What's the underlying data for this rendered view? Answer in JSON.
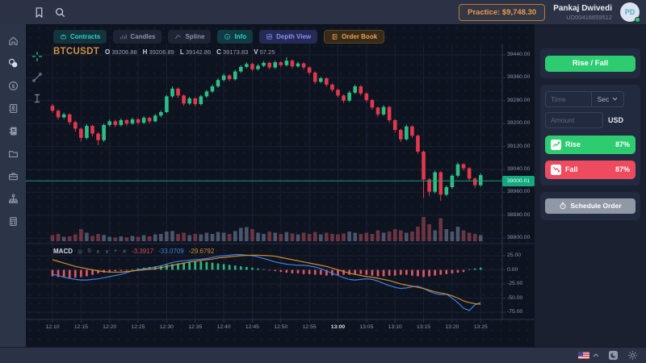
{
  "topbar": {
    "practice_label": "Practice: $9,748.30",
    "user_name": "Pankaj Dwivedi",
    "user_id": "UD00416659512",
    "avatar_initials": "PD"
  },
  "toolbar": {
    "chips": [
      {
        "icon": "briefcase-icon",
        "label": "Contracts"
      },
      {
        "icon": "bar-chart-icon",
        "label": "Candles"
      },
      {
        "icon": "line-chart-icon",
        "label": "Spline"
      },
      {
        "icon": "info-icon",
        "label": "Info"
      },
      {
        "icon": "depth-icon",
        "label": "Depth View"
      },
      {
        "icon": "book-icon",
        "label": "Order Book"
      }
    ]
  },
  "sidebar_icons": [
    "home-icon",
    "coins-icon",
    "dollar-coin-icon",
    "contacts-icon",
    "ledger-icon",
    "folder-icon",
    "briefcase-icon",
    "network-icon",
    "calculator-icon"
  ],
  "symbol_header": {
    "symbol": "BTCUSDT",
    "o_label": "O",
    "o": "39206.88",
    "h_label": "H",
    "h": "39206.89",
    "l_label": "L",
    "l": "39142.86",
    "c_label": "C",
    "c": "39173.83",
    "v_label": "V",
    "v": "57.25"
  },
  "macd_header": {
    "title": "MACD",
    "controls": [
      "◎",
      "S",
      "∧",
      "∨",
      "+",
      "✕"
    ],
    "hist_value": "-3.3917",
    "macd_value": "-33.0709",
    "signal_value": "-29.6792"
  },
  "price_tag": "39000.01",
  "right_panel": {
    "rise_fall_label": "Rise / Fall",
    "time_placeholder": "Time",
    "time_unit": "Sec",
    "amount_placeholder": "Amount",
    "currency": "USD",
    "rise_label": "Rise",
    "rise_pct": "87%",
    "fall_label": "Fall",
    "fall_pct": "87%",
    "schedule_label": "Schedule Order"
  },
  "colors": {
    "candle_up": "#2ebd85",
    "candle_down": "#e1384c",
    "vol_up": "#55617a",
    "vol_down": "#7c3b49",
    "hist_up": "#2ebd85",
    "hist_down": "#e25a68",
    "macd_line": "#3f7fe0",
    "signal_line": "#cf8a33",
    "price_line": "#16a57b",
    "grid": "#1a2133",
    "axis": "#2c3550",
    "accent_green": "#2ecc71",
    "accent_red": "#ee4b5f",
    "accent_orange": "#eb9b49",
    "accent_teal": "#2bd4c4",
    "accent_purple": "#8a8ff4"
  },
  "chart_data": {
    "type": "candlestick",
    "title": "BTCUSDT 1-minute candles with volume and MACD",
    "x_labels": [
      "12:10",
      "12:15",
      "12:20",
      "12:25",
      "12:30",
      "12:35",
      "12:40",
      "12:45",
      "12:50",
      "12:55",
      "13:00",
      "13:05",
      "13:10",
      "13:15",
      "13:20",
      "13:25"
    ],
    "highlighted_x_label": "13:00",
    "price_ticks": [
      39440,
      39360,
      39280,
      39200,
      39120,
      39040,
      38960,
      38880,
      38800
    ],
    "price_range": [
      38790,
      39460
    ],
    "current_price": 39000.01,
    "candles": [
      [
        39262,
        39268,
        39238,
        39245
      ],
      [
        39245,
        39250,
        39214,
        39222
      ],
      [
        39222,
        39238,
        39216,
        39232
      ],
      [
        39232,
        39236,
        39196,
        39205
      ],
      [
        39205,
        39210,
        39172,
        39182
      ],
      [
        39182,
        39186,
        39138,
        39150
      ],
      [
        39150,
        39198,
        39144,
        39192
      ],
      [
        39192,
        39196,
        39155,
        39165
      ],
      [
        39165,
        39170,
        39125,
        39142
      ],
      [
        39142,
        39200,
        39136,
        39195
      ],
      [
        39195,
        39214,
        39190,
        39208
      ],
      [
        39208,
        39213,
        39188,
        39195
      ],
      [
        39195,
        39218,
        39190,
        39212
      ],
      [
        39212,
        39216,
        39193,
        39200
      ],
      [
        39200,
        39221,
        39196,
        39215
      ],
      [
        39215,
        39219,
        39196,
        39203
      ],
      [
        39203,
        39226,
        39198,
        39220
      ],
      [
        39220,
        39224,
        39200,
        39208
      ],
      [
        39208,
        39234,
        39204,
        39228
      ],
      [
        39228,
        39246,
        39222,
        39240
      ],
      [
        39240,
        39300,
        39236,
        39295
      ],
      [
        39295,
        39330,
        39290,
        39322
      ],
      [
        39322,
        39326,
        39290,
        39298
      ],
      [
        39298,
        39302,
        39262,
        39270
      ],
      [
        39270,
        39294,
        39265,
        39288
      ],
      [
        39288,
        39292,
        39260,
        39268
      ],
      [
        39268,
        39300,
        39263,
        39295
      ],
      [
        39295,
        39318,
        39290,
        39312
      ],
      [
        39312,
        39336,
        39307,
        39330
      ],
      [
        39330,
        39358,
        39325,
        39352
      ],
      [
        39352,
        39374,
        39347,
        39368
      ],
      [
        39368,
        39372,
        39348,
        39355
      ],
      [
        39355,
        39388,
        39350,
        39382
      ],
      [
        39382,
        39404,
        39377,
        39398
      ],
      [
        39398,
        39414,
        39393,
        39408
      ],
      [
        39408,
        39412,
        39383,
        39390
      ],
      [
        39390,
        39408,
        39385,
        39402
      ],
      [
        39402,
        39418,
        39397,
        39412
      ],
      [
        39412,
        39416,
        39389,
        39396
      ],
      [
        39396,
        39420,
        39391,
        39414
      ],
      [
        39414,
        39418,
        39397,
        39404
      ],
      [
        39404,
        39432,
        39399,
        39420
      ],
      [
        39420,
        39424,
        39393,
        39400
      ],
      [
        39400,
        39416,
        39395,
        39410
      ],
      [
        39410,
        39414,
        39389,
        39396
      ],
      [
        39396,
        39400,
        39371,
        39378
      ],
      [
        39378,
        39382,
        39338,
        39346
      ],
      [
        39346,
        39364,
        39341,
        39358
      ],
      [
        39358,
        39362,
        39329,
        39336
      ],
      [
        39336,
        39340,
        39311,
        39318
      ],
      [
        39318,
        39322,
        39291,
        39298
      ],
      [
        39298,
        39302,
        39272,
        39280
      ],
      [
        39280,
        39314,
        39275,
        39308
      ],
      [
        39308,
        39336,
        39303,
        39330
      ],
      [
        39330,
        39334,
        39298,
        39305
      ],
      [
        39305,
        39309,
        39274,
        39282
      ],
      [
        39282,
        39286,
        39248,
        39256
      ],
      [
        39256,
        39260,
        39224,
        39232
      ],
      [
        39232,
        39264,
        39227,
        39258
      ],
      [
        39258,
        39262,
        39204,
        39212
      ],
      [
        39212,
        39216,
        39170,
        39178
      ],
      [
        39178,
        39182,
        39136,
        39145
      ],
      [
        39145,
        39196,
        39140,
        39190
      ],
      [
        39190,
        39194,
        39150,
        39158
      ],
      [
        39158,
        39162,
        39094,
        39102
      ],
      [
        39102,
        39106,
        38940,
        39005
      ],
      [
        39005,
        39010,
        38948,
        38962
      ],
      [
        38962,
        39036,
        38956,
        39030
      ],
      [
        39030,
        39034,
        38930,
        38952
      ],
      [
        38952,
        38984,
        38946,
        38978
      ],
      [
        38978,
        39024,
        38972,
        39018
      ],
      [
        39018,
        39064,
        39012,
        39058
      ],
      [
        39058,
        39062,
        39036,
        39044
      ],
      [
        39044,
        39048,
        39000,
        39008
      ],
      [
        39008,
        39012,
        38976,
        38985
      ],
      [
        38985,
        39026,
        38980,
        39020
      ]
    ],
    "volume": [
      0.25,
      0.3,
      0.18,
      0.2,
      0.28,
      0.5,
      0.35,
      0.22,
      0.3,
      0.26,
      0.18,
      0.15,
      0.2,
      0.16,
      0.22,
      0.18,
      0.25,
      0.2,
      0.28,
      0.3,
      0.4,
      0.42,
      0.3,
      0.35,
      0.25,
      0.3,
      0.28,
      0.35,
      0.3,
      0.38,
      0.35,
      0.3,
      0.42,
      0.55,
      0.58,
      0.5,
      0.35,
      0.3,
      0.4,
      0.35,
      0.3,
      0.38,
      0.32,
      0.28,
      0.35,
      0.3,
      0.38,
      0.28,
      0.35,
      0.3,
      0.28,
      0.32,
      0.4,
      0.35,
      0.3,
      0.35,
      0.3,
      0.45,
      0.35,
      0.4,
      0.5,
      0.45,
      0.35,
      0.4,
      0.6,
      1.0,
      0.7,
      0.45,
      0.95,
      0.5,
      0.4,
      0.6,
      0.45,
      0.35,
      0.3,
      0.25
    ],
    "macd": {
      "y_ticks": [
        25,
        0,
        -25,
        -50,
        -75
      ],
      "histogram": [
        -9,
        -10,
        -11,
        -12,
        -11,
        -10,
        -9,
        -7,
        -5,
        -4,
        -3,
        -2,
        -1.5,
        -1,
        1,
        2,
        3,
        4,
        5,
        6,
        7,
        8,
        9,
        10,
        11,
        12,
        12,
        11,
        10,
        9,
        8,
        7,
        6,
        5,
        4,
        3,
        2,
        1,
        -1,
        -2,
        -3,
        -4,
        -5,
        -5,
        -6,
        -6,
        -7,
        -7,
        -8,
        -8,
        -8,
        -7,
        -7,
        -6,
        -6,
        -7,
        -8,
        -9,
        -9,
        -8,
        -8,
        -7,
        -7,
        -8,
        -9,
        -10,
        -9,
        -8,
        -7,
        -6,
        -5,
        -4,
        -3,
        1,
        2,
        3
      ],
      "macd_line": [
        -8,
        -10,
        -13,
        -15,
        -17,
        -18,
        -18,
        -17,
        -16,
        -14,
        -12,
        -10,
        -8,
        -5,
        -2,
        0,
        2,
        3,
        5,
        7,
        10,
        13,
        15,
        16,
        17,
        18,
        19,
        20,
        22,
        24,
        25,
        26,
        27,
        27,
        26,
        25,
        23,
        20,
        17,
        14,
        12,
        10,
        9,
        8,
        8,
        7,
        5,
        2,
        -2,
        -6,
        -10,
        -14,
        -17,
        -18,
        -17,
        -16,
        -17,
        -20,
        -24,
        -28,
        -31,
        -33,
        -32,
        -30,
        -29,
        -33,
        -38,
        -42,
        -44,
        -43,
        -50,
        -58,
        -68,
        -72,
        -62,
        -58
      ],
      "signal_line": [
        18,
        15,
        12,
        9,
        6,
        4,
        2,
        0,
        -2,
        -3,
        -4,
        -4,
        -4,
        -3,
        -2,
        -1,
        0,
        1,
        2,
        4,
        6,
        8,
        10,
        12,
        14,
        15,
        17,
        18,
        19,
        21,
        22,
        23,
        24,
        25,
        25.5,
        26,
        26,
        25.5,
        25,
        24,
        22,
        20,
        18,
        16,
        14,
        12,
        10,
        8,
        6,
        3,
        0,
        -3,
        -6,
        -8,
        -10,
        -12,
        -13,
        -15,
        -17,
        -19,
        -22,
        -25,
        -27,
        -29,
        -31,
        -33,
        -36,
        -39,
        -41,
        -43,
        -46,
        -50,
        -55,
        -58,
        -60,
        -61
      ]
    }
  }
}
